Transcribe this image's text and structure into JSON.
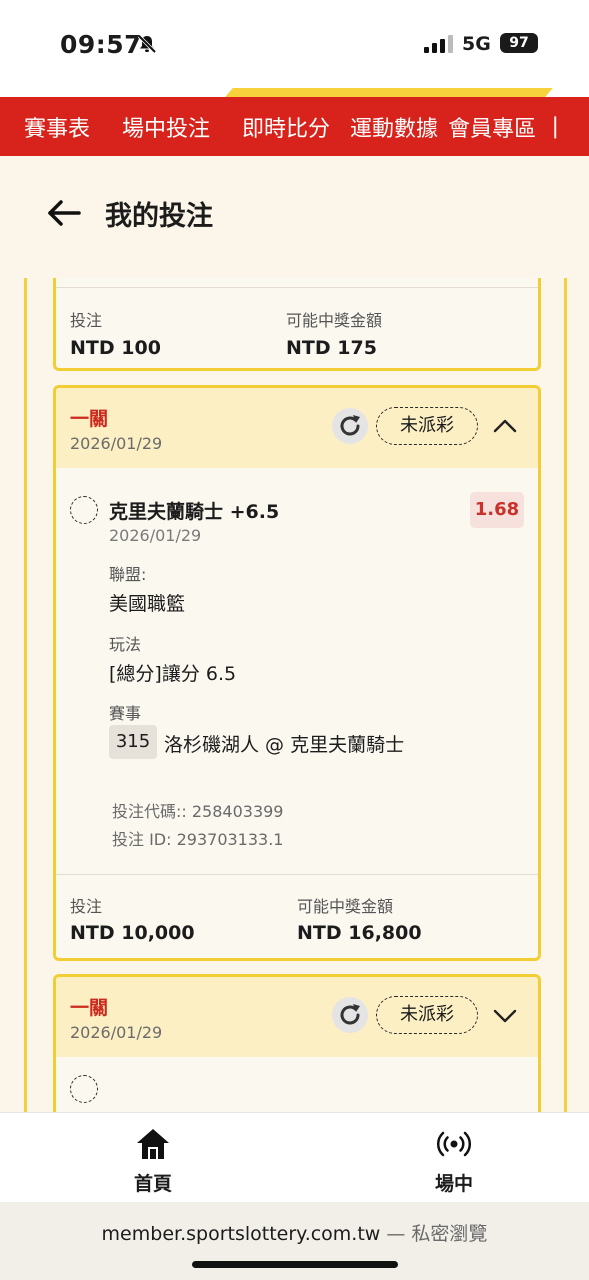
{
  "status_bar": {
    "time": "09:57",
    "network": "5G",
    "battery": "97"
  },
  "nav": {
    "items": [
      "賽事表",
      "場中投注",
      "即時比分",
      "運動數據",
      "會員專區",
      "❘"
    ]
  },
  "header": {
    "title": "我的投注"
  },
  "prev_card": {
    "stake_label": "投注",
    "stake_value": "NTD 100",
    "payout_label": "可能中獎金額",
    "payout_value": "NTD 175"
  },
  "main_card": {
    "bet_type": "一關",
    "date": "2026/01/29",
    "status": "未派彩",
    "selection": {
      "name": "克里夫蘭騎士 +6.5",
      "odds": "1.68",
      "date": "2026/01/29",
      "league_label": "聯盟:",
      "league_value": "美國職籃",
      "market_label": "玩法",
      "market_value": "[總分]讓分 6.5",
      "event_label": "賽事",
      "event_code": "315",
      "event_name": "洛杉磯湖人 @ 克里夫蘭騎士",
      "bet_code": "投注代碼:: 258403399",
      "bet_id": "投注 ID: 293703133.1"
    },
    "stake_label": "投注",
    "stake_value": "NTD 10,000",
    "payout_label": "可能中獎金額",
    "payout_value": "NTD 16,800"
  },
  "next_card": {
    "bet_type": "一關",
    "date": "2026/01/29",
    "status": "未派彩"
  },
  "tabbar": {
    "home_label": "首頁",
    "live_label": "場中"
  },
  "browser": {
    "domain": "member.sportslottery.com.tw",
    "private": " — 私密瀏覽"
  },
  "colors": {
    "nav_red": "#d8231c",
    "accent_yellow": "#f2cd34",
    "odds_red": "#c8322a"
  }
}
